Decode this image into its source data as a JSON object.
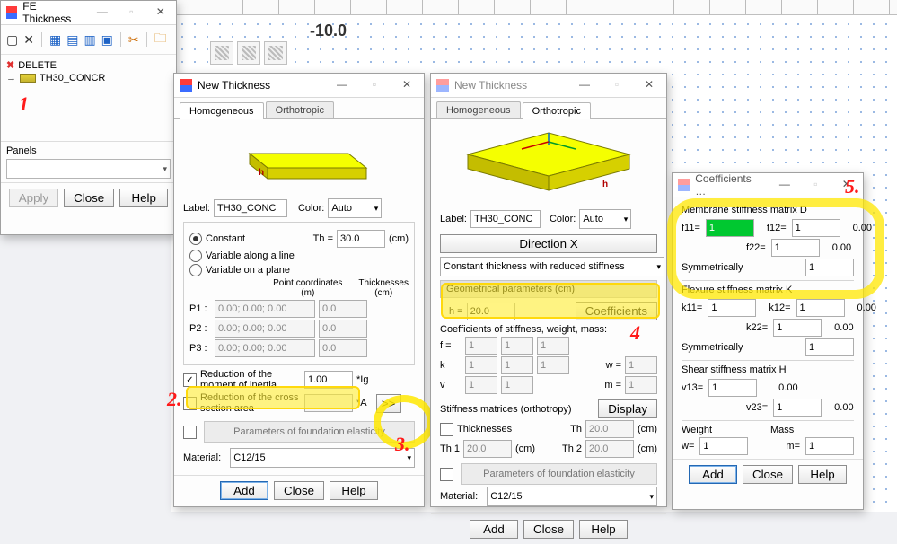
{
  "canvas": {
    "coord": "-10.0"
  },
  "feThickness": {
    "title": "FE Thickness",
    "tree": [
      {
        "icon": "del",
        "label": "DELETE"
      },
      {
        "icon": "slab",
        "label": "TH30_CONCR"
      }
    ],
    "panels_label": "Panels",
    "buttons": {
      "apply": "Apply",
      "close": "Close",
      "help": "Help"
    }
  },
  "nt1": {
    "title": "New Thickness",
    "tabs": {
      "homog": "Homogeneous",
      "ortho": "Orthotropic"
    },
    "label_label": "Label:",
    "label_value": "TH30_CONC",
    "color_label": "Color:",
    "color_value": "Auto",
    "opt_constant": "Constant",
    "th_label": "Th =",
    "th_value": "30.0",
    "th_unit": "(cm)",
    "opt_line": "Variable along a line",
    "opt_plane": "Variable on a plane",
    "pt_hdr1": "Point coordinates",
    "pt_hdr1u": "(m)",
    "pt_hdr2": "Thicknesses",
    "pt_hdr2u": "(cm)",
    "rows": [
      {
        "p": "P1 :",
        "c": "0.00; 0.00; 0.00",
        "t": "0.0"
      },
      {
        "p": "P2 :",
        "c": "0.00; 0.00; 0.00",
        "t": "0.0"
      },
      {
        "p": "P3 :",
        "c": "0.00; 0.00; 0.00",
        "t": "0.0"
      }
    ],
    "red_inertia": "Reduction of the moment of inertia",
    "red_inertia_val": "1.00",
    "red_inertia_suf": "*Ig",
    "red_cross": "Reduction of the cross section area",
    "red_cross_suf": "*A",
    "expand": ">>",
    "found": "Parameters of foundation elasticity",
    "material_label": "Material:",
    "material_value": "C12/15",
    "buttons": {
      "add": "Add",
      "close": "Close",
      "help": "Help"
    }
  },
  "nt2": {
    "title": "New Thickness",
    "tabs": {
      "homog": "Homogeneous",
      "ortho": "Orthotropic"
    },
    "label_label": "Label:",
    "label_value": "TH30_CONC",
    "color_label": "Color:",
    "color_value": "Auto",
    "dirx": "Direction X",
    "method": "Constant thickness with reduced stiffness",
    "geom_hdr": "Geometrical parameters (cm)",
    "h_label": "h =",
    "h_value": "20.0",
    "coeff_btn": "Coefficients",
    "cwm_hdr": "Coefficients of stiffness, weight, mass:",
    "cwm": {
      "rows": [
        {
          "l": "f =",
          "a": "1",
          "b": "1",
          "c": "1"
        },
        {
          "l": "k",
          "a": "1",
          "b": "1",
          "c": "1",
          "r": "w =",
          "rv": "1"
        },
        {
          "l": "v",
          "a": "1",
          "b": "1",
          "c": "",
          "r": "m =",
          "rv": "1"
        }
      ]
    },
    "stiff_hdr": "Stiffness matrices (orthotropy)",
    "display_btn": "Display",
    "thick_chk": "Thicknesses",
    "th_label": "Th",
    "th_unit": "(cm)",
    "th1_label": "Th 1",
    "th1_value": "20.0",
    "th2_label": "Th 2",
    "th2_value": "20.0",
    "th_value": "20.0",
    "found": "Parameters of foundation elasticity",
    "material_label": "Material:",
    "material_value": "C12/15",
    "buttons": {
      "add": "Add",
      "close": "Close",
      "help": "Help"
    }
  },
  "coeff": {
    "title": "Coefficients …",
    "mem_hdr": "Membrane stiffness matrix D",
    "f11_l": "f11=",
    "f11_v": "1",
    "f12_l": "f12=",
    "f12_v": "1",
    "f12_r": "0.00",
    "f22_l": "f22=",
    "f22_v": "1",
    "f22_r": "0.00",
    "sym": "Symmetrically",
    "sym_v": "1",
    "flex_hdr": "Flexure stiffness matrix K",
    "k11_l": "k11=",
    "k11_v": "1",
    "k12_l": "k12=",
    "k12_v": "1",
    "k12_r": "0.00",
    "k22_l": "k22=",
    "k22_v": "1",
    "k22_r": "0.00",
    "sym2_v": "1",
    "shear_hdr": "Shear stiffness matrix H",
    "v13_l": "v13=",
    "v13_v": "1",
    "v13_r": "0.00",
    "v23_l": "v23=",
    "v23_v": "1",
    "v23_r": "0.00",
    "w_l": "Weight",
    "m_l": "Mass",
    "w_eq": "w=",
    "w_v": "1",
    "m_eq": "m=",
    "m_v": "1",
    "buttons": {
      "add": "Add",
      "close": "Close",
      "help": "Help"
    }
  }
}
